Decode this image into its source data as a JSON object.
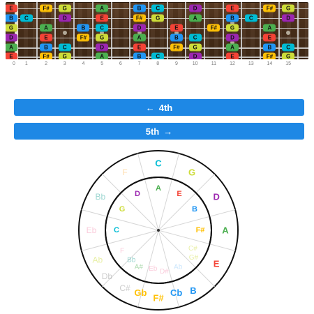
{
  "colors": {
    "A": "#4caf50",
    "B": "#2196f3",
    "C": "#00bcd4",
    "D": "#9c27b0",
    "E": "#f44336",
    "F#": "#ffc107",
    "G": "#cddc39",
    "button_bg": "#1e88e5"
  },
  "fretboard": {
    "strings": [
      {
        "notes": [
          {
            "fret": 0,
            "label": "E"
          },
          {
            "fret": 2,
            "label": "F#"
          },
          {
            "fret": 3,
            "label": "G"
          },
          {
            "fret": 5,
            "label": "A"
          },
          {
            "fret": 7,
            "label": "B"
          },
          {
            "fret": 8,
            "label": "C"
          },
          {
            "fret": 10,
            "label": "D"
          },
          {
            "fret": 12,
            "label": "E"
          },
          {
            "fret": 14,
            "label": "F#"
          },
          {
            "fret": 15,
            "label": "G"
          }
        ]
      },
      {
        "notes": [
          {
            "fret": 0,
            "label": "B"
          },
          {
            "fret": 1,
            "label": "C"
          },
          {
            "fret": 3,
            "label": "D"
          },
          {
            "fret": 5,
            "label": "E"
          },
          {
            "fret": 7,
            "label": "F#"
          },
          {
            "fret": 8,
            "label": "G"
          },
          {
            "fret": 10,
            "label": "A"
          },
          {
            "fret": 12,
            "label": "B"
          },
          {
            "fret": 13,
            "label": "C"
          },
          {
            "fret": 15,
            "label": "D"
          }
        ]
      },
      {
        "notes": [
          {
            "fret": 0,
            "label": "G"
          },
          {
            "fret": 2,
            "label": "A"
          },
          {
            "fret": 4,
            "label": "B"
          },
          {
            "fret": 5,
            "label": "C"
          },
          {
            "fret": 7,
            "label": "D"
          },
          {
            "fret": 9,
            "label": "E"
          },
          {
            "fret": 11,
            "label": "F#"
          },
          {
            "fret": 12,
            "label": "G"
          },
          {
            "fret": 14,
            "label": "A"
          },
          {
            "fret": 16,
            "label": "B"
          }
        ]
      },
      {
        "notes": [
          {
            "fret": 0,
            "label": "D"
          },
          {
            "fret": 2,
            "label": "E"
          },
          {
            "fret": 4,
            "label": "F#"
          },
          {
            "fret": 5,
            "label": "G"
          },
          {
            "fret": 7,
            "label": "A"
          },
          {
            "fret": 9,
            "label": "B"
          },
          {
            "fret": 10,
            "label": "C"
          },
          {
            "fret": 12,
            "label": "D"
          },
          {
            "fret": 14,
            "label": "E"
          },
          {
            "fret": 16,
            "label": "F#"
          }
        ]
      },
      {
        "notes": [
          {
            "fret": 0,
            "label": "A"
          },
          {
            "fret": 2,
            "label": "B"
          },
          {
            "fret": 3,
            "label": "C"
          },
          {
            "fret": 5,
            "label": "D"
          },
          {
            "fret": 7,
            "label": "E"
          },
          {
            "fret": 9,
            "label": "F#"
          },
          {
            "fret": 10,
            "label": "G"
          },
          {
            "fret": 12,
            "label": "A"
          },
          {
            "fret": 14,
            "label": "B"
          },
          {
            "fret": 15,
            "label": "C"
          }
        ]
      },
      {
        "notes": [
          {
            "fret": 0,
            "label": "E"
          },
          {
            "fret": 2,
            "label": "F#"
          },
          {
            "fret": 3,
            "label": "G"
          },
          {
            "fret": 5,
            "label": "A"
          },
          {
            "fret": 7,
            "label": "B"
          },
          {
            "fret": 8,
            "label": "C"
          },
          {
            "fret": 10,
            "label": "D"
          },
          {
            "fret": 12,
            "label": "E"
          },
          {
            "fret": 14,
            "label": "F#"
          },
          {
            "fret": 15,
            "label": "G"
          }
        ]
      }
    ],
    "fret_numbers": [
      "0",
      "1",
      "2",
      "3",
      "4",
      "5",
      "6",
      "7",
      "8",
      "9",
      "10",
      "11",
      "12",
      "13",
      "14",
      "15"
    ]
  },
  "buttons": {
    "fourth": {
      "label": "4th",
      "arrow": "←"
    },
    "fifth": {
      "label": "5th",
      "arrow": "→"
    }
  },
  "circle_of_fifths": {
    "outer": [
      {
        "label": "C",
        "color": "#00bcd4",
        "faded": false
      },
      {
        "label": "G",
        "color": "#cddc39",
        "faded": false
      },
      {
        "label": "D",
        "color": "#9c27b0",
        "faded": false
      },
      {
        "label": "A",
        "color": "#4caf50",
        "faded": false
      },
      {
        "label": "E",
        "color": "#f44336",
        "faded": false
      },
      {
        "label": "B",
        "color": "#2196f3",
        "faded": false
      },
      {
        "label": "Cb",
        "color": "#2196f3",
        "faded": false
      },
      {
        "label": "F#",
        "color": "#ffc107",
        "faded": false
      },
      {
        "label": "Gb",
        "color": "#ffc107",
        "faded": false
      },
      {
        "label": "C#",
        "color": "#8f8f8f",
        "faded": true
      },
      {
        "label": "Db",
        "color": "#8f8f8f",
        "faded": true
      },
      {
        "label": "Ab",
        "color": "#cddc39",
        "faded": true
      },
      {
        "label": "Eb",
        "color": "#f48fb1",
        "faded": true
      },
      {
        "label": "Bb",
        "color": "#26a69a",
        "faded": true
      },
      {
        "label": "F",
        "color": "#ffb74d",
        "faded": true
      }
    ],
    "inner": [
      {
        "label": "A",
        "color": "#4caf50",
        "faded": false
      },
      {
        "label": "E",
        "color": "#f44336",
        "faded": false
      },
      {
        "label": "B",
        "color": "#2196f3",
        "faded": false
      },
      {
        "label": "F#",
        "color": "#ffc107",
        "faded": false
      },
      {
        "label": "C#",
        "color": "#cddc39",
        "faded": true
      },
      {
        "label": "G#",
        "color": "#cddc39",
        "faded": true
      },
      {
        "label": "Ab",
        "color": "#90caf9",
        "faded": true
      },
      {
        "label": "D#",
        "color": "#f48fb1",
        "faded": true
      },
      {
        "label": "Eb",
        "color": "#f48fb1",
        "faded": true
      },
      {
        "label": "A#",
        "color": "#4caf50",
        "faded": true
      },
      {
        "label": "Bb",
        "color": "#26a69a",
        "faded": true
      },
      {
        "label": "F",
        "color": "#f48fb1",
        "faded": true
      },
      {
        "label": "C",
        "color": "#00bcd4",
        "faded": false
      },
      {
        "label": "G",
        "color": "#cddc39",
        "faded": false
      },
      {
        "label": "D",
        "color": "#9c27b0",
        "faded": false
      }
    ]
  }
}
